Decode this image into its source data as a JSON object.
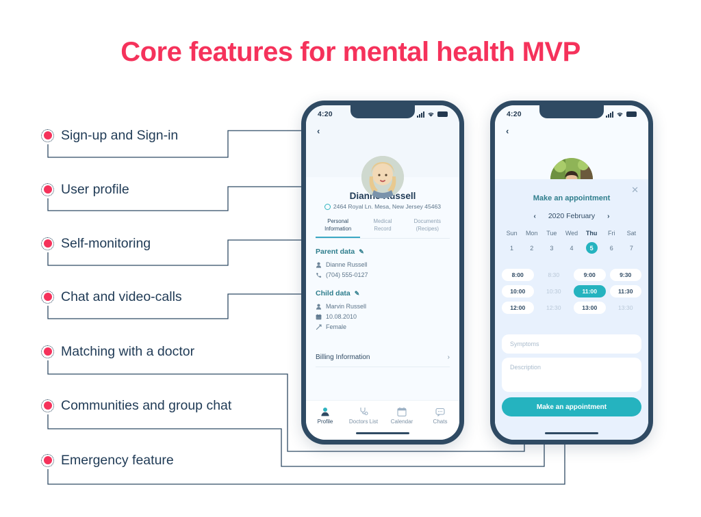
{
  "page": {
    "title": "Core features for mental health MVP",
    "accent_red": "#f5325b",
    "accent_navy": "#1f3a55",
    "accent_teal": "#25b3bf"
  },
  "features": [
    {
      "label": "Sign-up and Sign-in"
    },
    {
      "label": "User profile"
    },
    {
      "label": "Self-monitoring"
    },
    {
      "label": "Chat and video-calls"
    },
    {
      "label": "Matching with a doctor"
    },
    {
      "label": "Communities and group chat"
    },
    {
      "label": "Emergency feature"
    }
  ],
  "phone1": {
    "status": {
      "time": "4:20"
    },
    "back": "‹",
    "profile": {
      "name": "Dianne Russell",
      "address": "2464 Royal Ln. Mesa, New Jersey 45463"
    },
    "tabs": [
      {
        "line1": "Personal",
        "line2": "Information",
        "active": true
      },
      {
        "line1": "Medical",
        "line2": "Record",
        "active": false
      },
      {
        "line1": "Documents",
        "line2": "(Recipes)",
        "active": false
      }
    ],
    "parent_section": {
      "title": "Parent data",
      "edit": "✎",
      "rows": [
        {
          "icon": "person-icon",
          "text": "Dianne Russell"
        },
        {
          "icon": "phone-icon",
          "text": "(704) 555-0127"
        }
      ]
    },
    "child_section": {
      "title": "Child data",
      "edit": "✎",
      "rows": [
        {
          "icon": "person-icon",
          "text": "Marvin Russell"
        },
        {
          "icon": "calendar-icon",
          "text": "10.08.2010"
        },
        {
          "icon": "gender-icon",
          "text": "Female"
        }
      ]
    },
    "billing": {
      "label": "Billing Information",
      "chevron": "›"
    },
    "tabbar": [
      {
        "label": "Profile",
        "icon": "profile-icon",
        "active": true
      },
      {
        "label": "Doctors List",
        "icon": "stethoscope-icon",
        "active": false
      },
      {
        "label": "Calendar",
        "icon": "calendar-icon",
        "active": false
      },
      {
        "label": "Chats",
        "icon": "chat-icon",
        "active": false
      }
    ]
  },
  "phone2": {
    "status": {
      "time": "4:20"
    },
    "back": "‹",
    "sheet": {
      "title": "Make an appointment",
      "close": "✕",
      "calendar": {
        "prev": "‹",
        "next": "›",
        "month_label": "2020 February",
        "dow": [
          "Sun",
          "Mon",
          "Tue",
          "Wed",
          "Thu",
          "Fri",
          "Sat"
        ],
        "highlight_dow": "Thu",
        "days": [
          "1",
          "2",
          "3",
          "4",
          "5",
          "6",
          "7"
        ],
        "selected_day": "5"
      },
      "slots": [
        {
          "time": "8:00",
          "state": "avail"
        },
        {
          "time": "8:30",
          "state": "off"
        },
        {
          "time": "9:00",
          "state": "avail"
        },
        {
          "time": "9:30",
          "state": "avail"
        },
        {
          "time": "10:00",
          "state": "avail"
        },
        {
          "time": "10:30",
          "state": "off"
        },
        {
          "time": "11:00",
          "state": "sel"
        },
        {
          "time": "11:30",
          "state": "avail"
        },
        {
          "time": "12:00",
          "state": "avail"
        },
        {
          "time": "12:30",
          "state": "off"
        },
        {
          "time": "13:00",
          "state": "avail"
        },
        {
          "time": "13:30",
          "state": "off"
        }
      ],
      "symptoms_placeholder": "Symptoms",
      "description_placeholder": "Description",
      "cta_label": "Make an appointment"
    }
  }
}
